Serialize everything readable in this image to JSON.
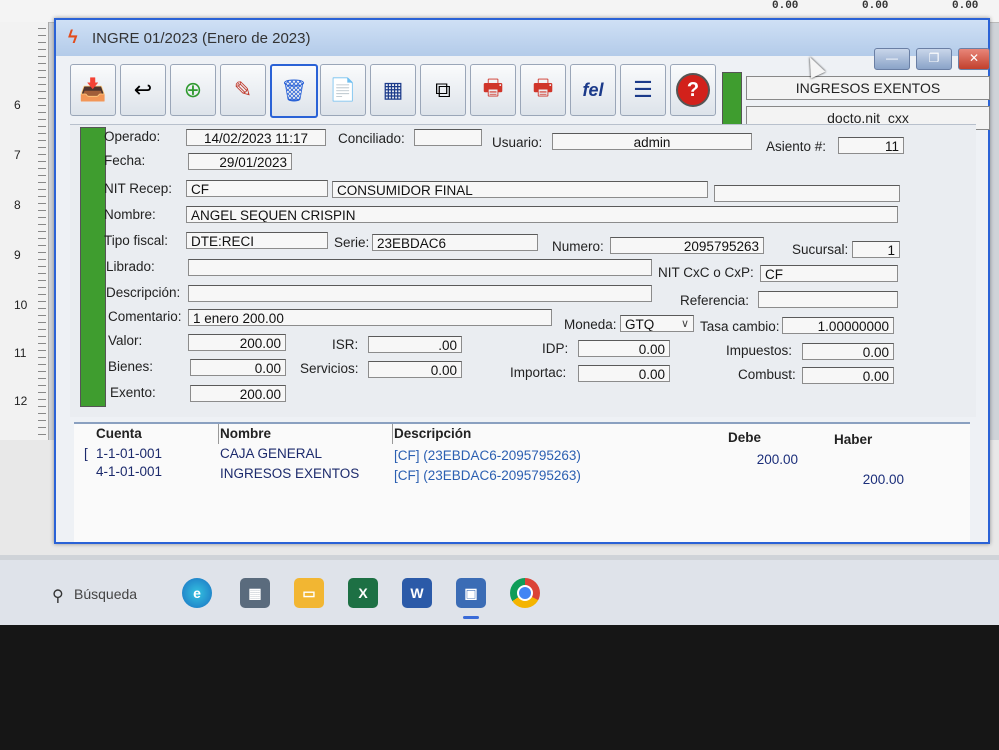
{
  "background": {
    "top_values": [
      "0.00",
      "0.00",
      "0.00"
    ],
    "ruler_numbers": [
      "6",
      "7",
      "8",
      "9",
      "10",
      "11",
      "12"
    ]
  },
  "window": {
    "title": "INGRE 01/2023 (Enero de 2023)",
    "controls": {
      "minimize": "—",
      "maximize": "❐",
      "close": "✕"
    }
  },
  "toolbar": {
    "buttons": [
      "save",
      "undo",
      "add",
      "edit",
      "delete",
      "document",
      "grid",
      "copy",
      "print",
      "print-alt",
      "fel",
      "list",
      "help"
    ],
    "fel_label": "fel",
    "help_label": "?"
  },
  "header_info": {
    "type": "INGRESOS EXENTOS",
    "docto": "docto.nit_cxx"
  },
  "form": {
    "operado_label": "Operado:",
    "operado": "14/02/2023 11:17",
    "conciliado_label": "Conciliado:",
    "conciliado": "",
    "usuario_label": "Usuario:",
    "usuario": "admin",
    "asiento_label": "Asiento #:",
    "asiento": "11",
    "fecha_label": "Fecha:",
    "fecha": "29/01/2023",
    "nit_recep_label": "NIT Recep:",
    "nit_recep": "CF",
    "nit_nombre": "CONSUMIDOR FINAL",
    "nit_extra": "",
    "nombre_label": "Nombre:",
    "nombre": "ANGEL SEQUEN CRISPIN",
    "tipo_fiscal_label": "Tipo fiscal:",
    "tipo_fiscal": "DTE:RECI",
    "serie_label": "Serie:",
    "serie": "23EBDAC6",
    "numero_label": "Numero:",
    "numero": "2095795263",
    "sucursal_label": "Sucursal:",
    "sucursal": "1",
    "librado_label": "Librado:",
    "librado": "",
    "nit_cxc_label": "NIT CxC o CxP:",
    "nit_cxc": "CF",
    "descripcion_label": "Descripción:",
    "descripcion": "",
    "referencia_label": "Referencia:",
    "referencia": "",
    "comentario_label": "Comentario:",
    "comentario": "1 enero 200.00",
    "moneda_label": "Moneda:",
    "moneda": "GTQ",
    "tasa_label": "Tasa cambio:",
    "tasa": "1.00000000",
    "valor_label": "Valor:",
    "valor": "200.00",
    "isr_label": "ISR:",
    "isr": ".00",
    "idp_label": "IDP:",
    "idp": "0.00",
    "impuestos_label": "Impuestos:",
    "impuestos": "0.00",
    "bienes_label": "Bienes:",
    "bienes": "0.00",
    "servicios_label": "Servicios:",
    "servicios": "0.00",
    "importac_label": "Importac:",
    "importac": "0.00",
    "combust_label": "Combust:",
    "combust": "0.00",
    "exento_label": "Exento:",
    "exento": "200.00"
  },
  "grid": {
    "headers": {
      "cuenta": "Cuenta",
      "nombre": "Nombre",
      "descripcion": "Descripción",
      "debe": "Debe",
      "haber": "Haber"
    },
    "rows": [
      {
        "cuenta": "1-1-01-001",
        "nombre": "CAJA GENERAL",
        "descripcion": "[CF] (23EBDAC6-2095795263)",
        "debe": "200.00",
        "haber": ""
      },
      {
        "cuenta": "4-1-01-001",
        "nombre": "INGRESOS EXENTOS",
        "descripcion": "[CF] (23EBDAC6-2095795263)",
        "debe": "",
        "haber": "200.00"
      }
    ]
  },
  "taskbar": {
    "search_label": "Búsqueda",
    "apps": [
      "edge",
      "calculator",
      "file-explorer",
      "excel",
      "word",
      "app",
      "chrome"
    ]
  }
}
